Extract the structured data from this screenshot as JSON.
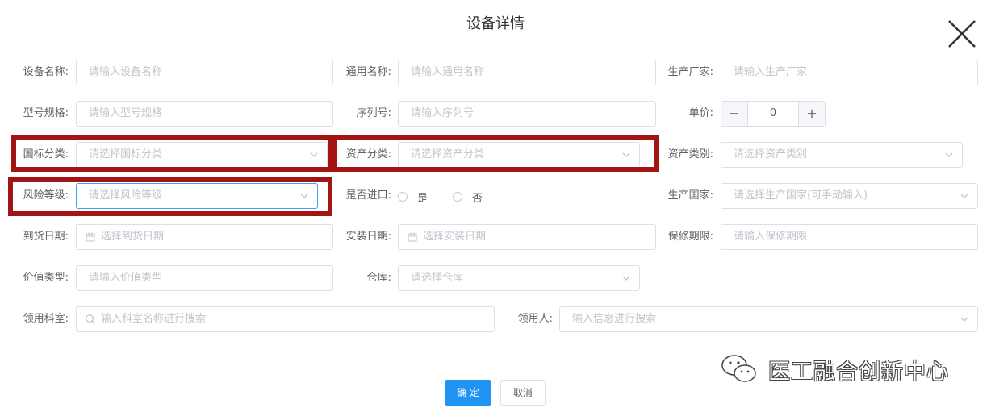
{
  "dialog": {
    "title": "设备详情"
  },
  "row1": {
    "name": {
      "label": "设备名称:",
      "placeholder": "请输入设备名称"
    },
    "common_name": {
      "label": "通用名称:",
      "placeholder": "请输入通用名称"
    },
    "manufacturer": {
      "label": "生产厂家:",
      "placeholder": "请输入生产厂家"
    }
  },
  "row2": {
    "model": {
      "label": "型号规格:",
      "placeholder": "请输入型号规格"
    },
    "serial": {
      "label": "序列号:",
      "placeholder": "请输入序列号"
    },
    "price": {
      "label": "单价:",
      "value": "0",
      "minus": "−",
      "plus": "+"
    }
  },
  "row3": {
    "national_class": {
      "label": "国标分类:",
      "placeholder": "请选择国标分类"
    },
    "asset_class": {
      "label": "资产分类:",
      "placeholder": "请选择资产分类"
    },
    "asset_type": {
      "label": "资产类别:",
      "placeholder": "请选择资产类别"
    }
  },
  "row4": {
    "risk_level": {
      "label": "风险等级:",
      "placeholder": "请选择风险等级"
    },
    "imported": {
      "label": "是否进口:",
      "options": [
        "是",
        "否"
      ]
    },
    "origin_country": {
      "label": "生产国家:",
      "placeholder": "请选择生产国家(可手动输入)"
    }
  },
  "row5": {
    "arrival_date": {
      "label": "到货日期:",
      "placeholder": "选择到货日期"
    },
    "install_date": {
      "label": "安装日期:",
      "placeholder": "选择安装日期"
    },
    "warranty": {
      "label": "保修期限:",
      "placeholder": "请输入保修期限"
    }
  },
  "row6": {
    "value_type": {
      "label": "价值类型:",
      "placeholder": "请输入价值类型"
    },
    "warehouse": {
      "label": "仓库:",
      "placeholder": "请选择仓库"
    }
  },
  "row7": {
    "department": {
      "label": "领用科室:",
      "placeholder": "输入科室名称进行搜索"
    },
    "recipient": {
      "label": "领用人:",
      "placeholder": "输入信息进行搜索"
    }
  },
  "footer": {
    "confirm": "确 定",
    "cancel": "取消"
  },
  "watermark": {
    "text": "医工融合创新中心",
    "icon": "wechat-icon"
  },
  "highlight_color": "#a31515",
  "accent_color": "#1f94f2"
}
